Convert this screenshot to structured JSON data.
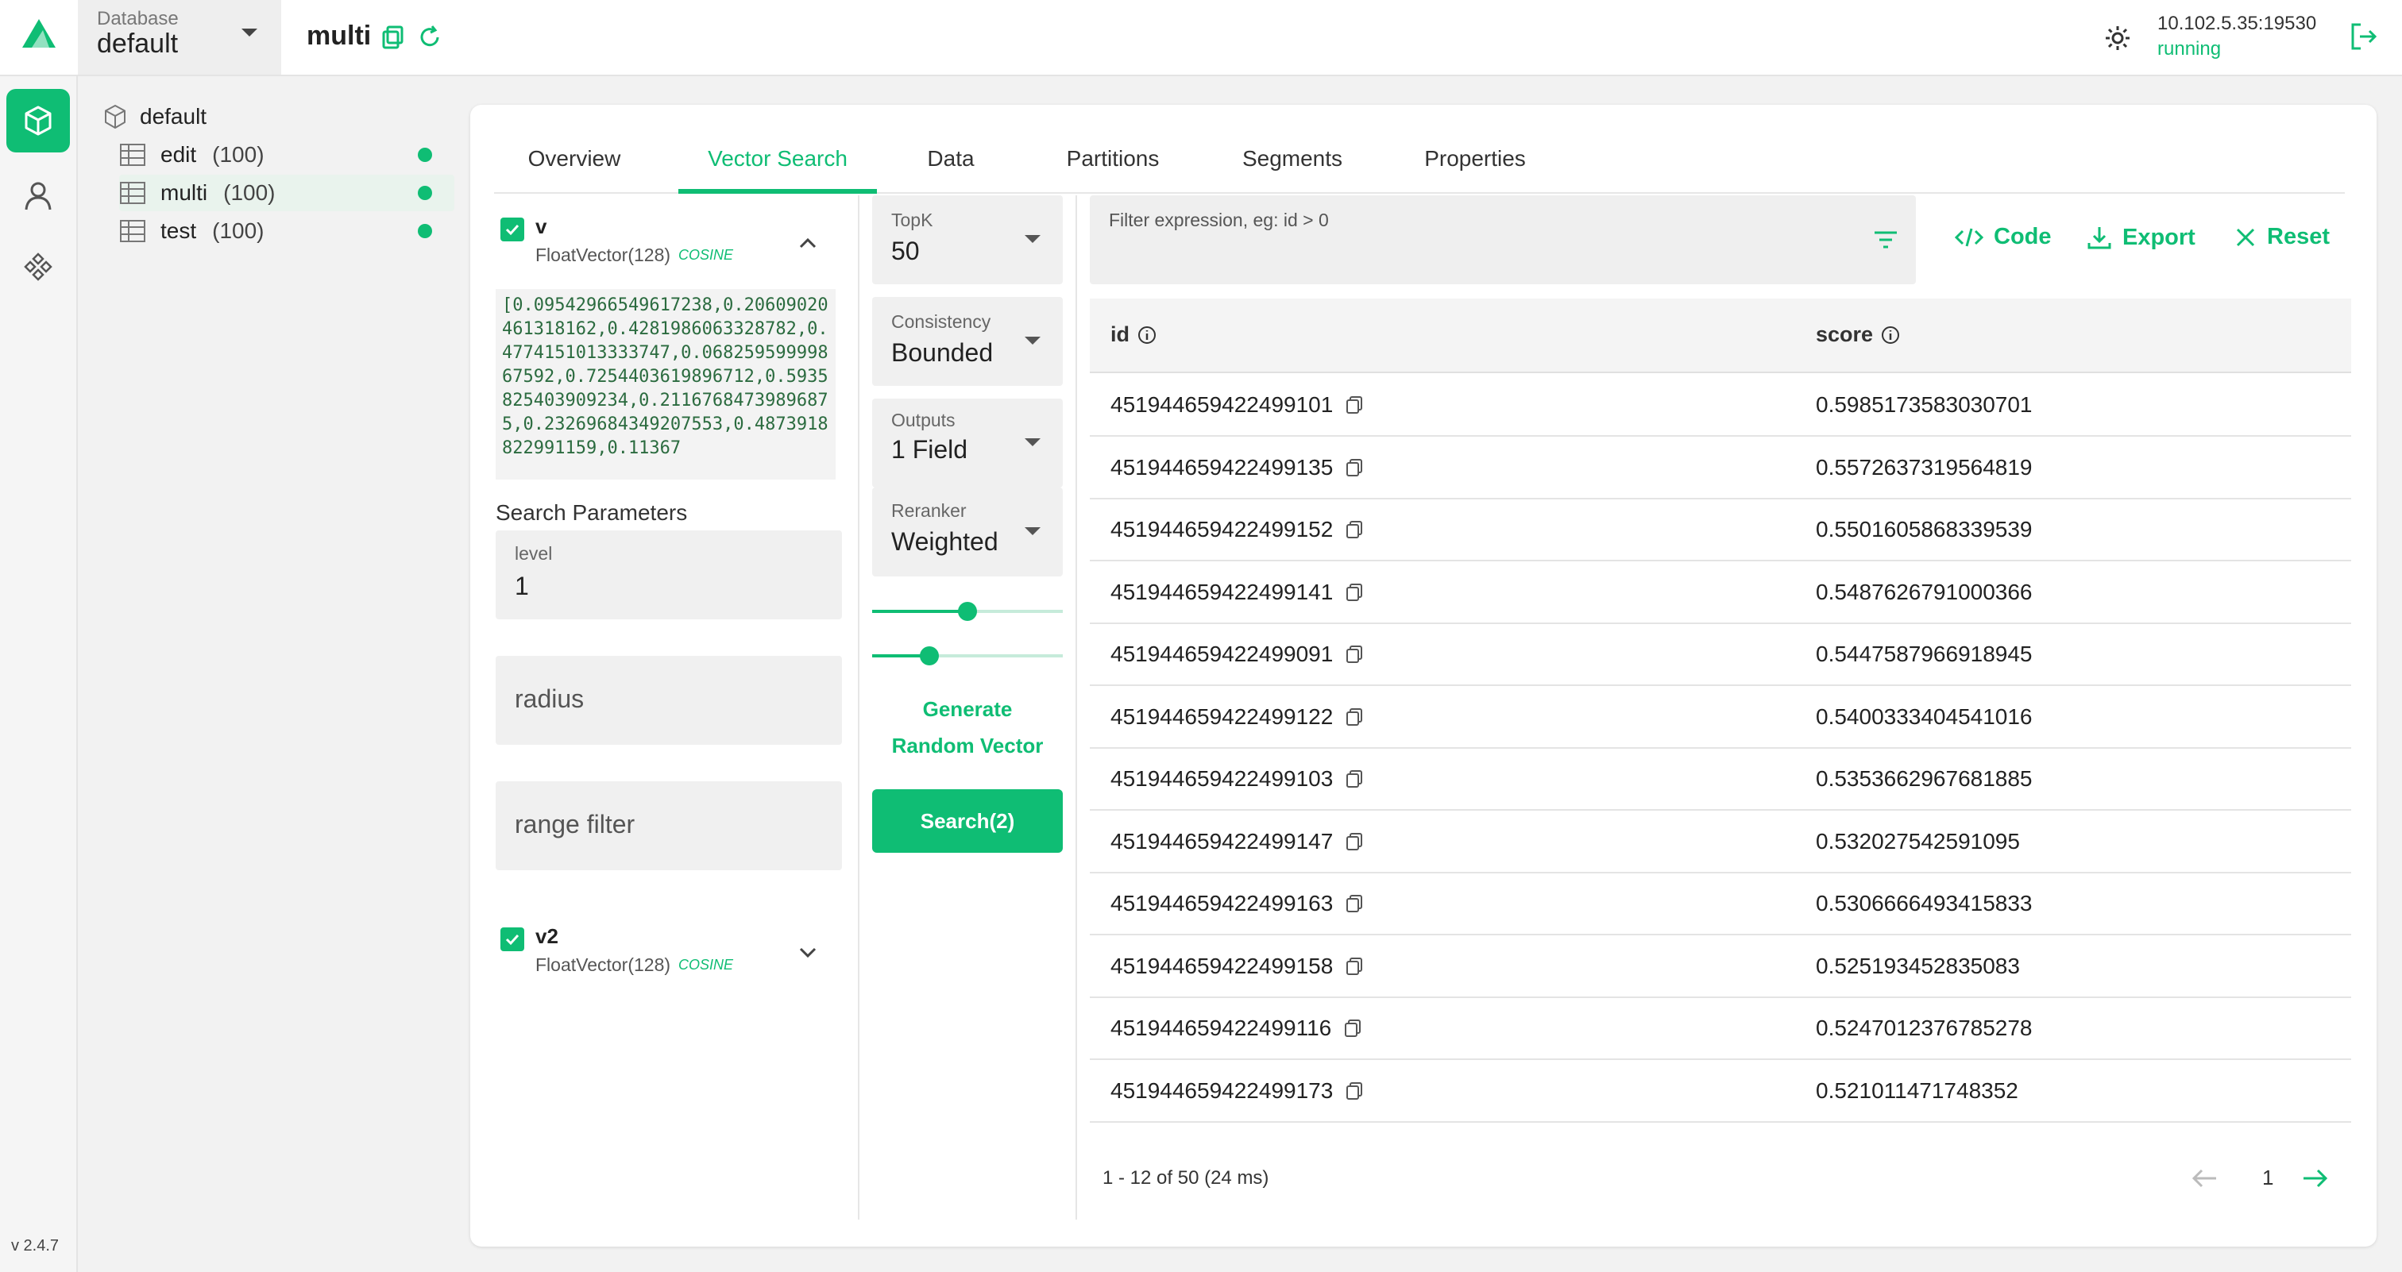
{
  "header": {
    "database_label": "Database",
    "database_value": "default",
    "collection_title": "multi",
    "server_address": "10.102.5.35:19530",
    "server_status": "running"
  },
  "app": {
    "version": "v 2.4.7",
    "accent": "#0fbd74"
  },
  "tree": {
    "root": "default",
    "items": [
      {
        "name": "edit",
        "count": "(100)"
      },
      {
        "name": "multi",
        "count": "(100)"
      },
      {
        "name": "test",
        "count": "(100)"
      }
    ]
  },
  "tabs": [
    "Overview",
    "Vector Search",
    "Data",
    "Partitions",
    "Segments",
    "Properties"
  ],
  "fields": [
    {
      "name": "v",
      "type": "FloatVector(128)",
      "metric": "COSINE",
      "vector_text": "[0.09542966549617238,0.20609020461318162,0.4281986063328782,0.4774151013333747,0.06825959999867592,0.7254403619896712,0.5935825403909234,0.21167684739896875,0.23269684349207553,0.4873918822991159,0.11367"
    },
    {
      "name": "v2",
      "type": "FloatVector(128)",
      "metric": "COSINE"
    }
  ],
  "search_params": {
    "title": "Search Parameters",
    "level_label": "level",
    "level_value": "1",
    "radius_placeholder": "radius",
    "range_placeholder": "range filter"
  },
  "settings": {
    "topk_label": "TopK",
    "topk_value": "50",
    "consistency_label": "Consistency",
    "consistency_value": "Bounded",
    "outputs_label": "Outputs",
    "outputs_value": "1 Field",
    "reranker_label": "Reranker",
    "reranker_value": "Weighted",
    "slider_weights": [
      0.5,
      0.3
    ],
    "generate_line1": "Generate",
    "generate_line2": "Random Vector",
    "search_button": "Search(2)"
  },
  "results": {
    "filter_placeholder": "Filter expression, eg: id > 0",
    "code_button": "Code",
    "export_button": "Export",
    "reset_button": "Reset",
    "columns": [
      "id",
      "score"
    ],
    "rows": [
      {
        "id": "451944659422499101",
        "score": "0.5985173583030701"
      },
      {
        "id": "451944659422499135",
        "score": "0.5572637319564819"
      },
      {
        "id": "451944659422499152",
        "score": "0.5501605868339539"
      },
      {
        "id": "451944659422499141",
        "score": "0.5487626791000366"
      },
      {
        "id": "451944659422499091",
        "score": "0.5447587966918945"
      },
      {
        "id": "451944659422499122",
        "score": "0.5400333404541016"
      },
      {
        "id": "451944659422499103",
        "score": "0.5353662967681885"
      },
      {
        "id": "451944659422499147",
        "score": "0.532027542591095"
      },
      {
        "id": "451944659422499163",
        "score": "0.5306666493415833"
      },
      {
        "id": "451944659422499158",
        "score": "0.525193452835083"
      },
      {
        "id": "451944659422499116",
        "score": "0.5247012376785278"
      },
      {
        "id": "451944659422499173",
        "score": "0.521011471748352"
      }
    ],
    "pagination_text": "1 - 12  of 50 (24 ms)",
    "current_page": "1"
  }
}
